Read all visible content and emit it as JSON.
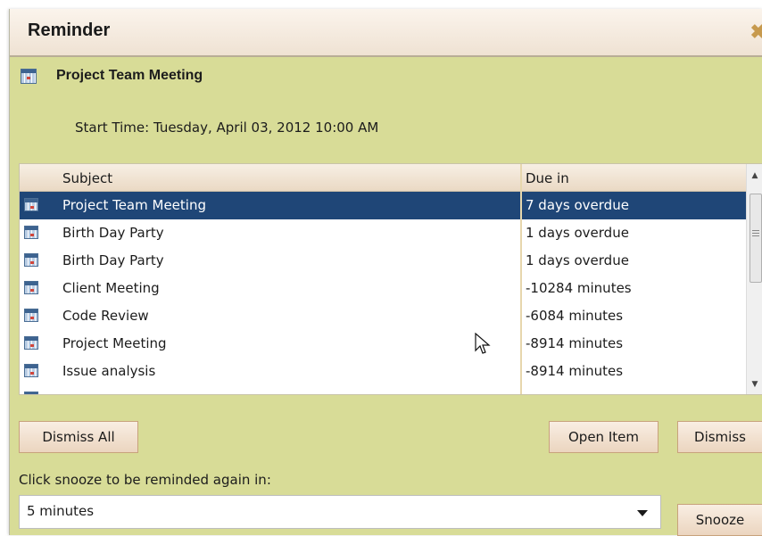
{
  "window": {
    "title": "Reminder",
    "close_glyph": "✖"
  },
  "header": {
    "item_title": "Project Team Meeting",
    "start_time": "Start Time: Tuesday, April 03, 2012 10:00 AM"
  },
  "list": {
    "columns": {
      "subject": "Subject",
      "due": "Due in"
    },
    "rows": [
      {
        "subject": "Project Team Meeting",
        "due": "7 days overdue",
        "selected": true
      },
      {
        "subject": "Birth Day Party",
        "due": "1 days overdue"
      },
      {
        "subject": "Birth Day Party",
        "due": "1 days overdue"
      },
      {
        "subject": "Client Meeting",
        "due": "-10284 minutes"
      },
      {
        "subject": "Code Review",
        "due": "-6084 minutes"
      },
      {
        "subject": "Project Meeting",
        "due": "-8914 minutes"
      },
      {
        "subject": "Issue analysis",
        "due": "-8914 minutes"
      }
    ]
  },
  "buttons": {
    "dismiss_all": "Dismiss All",
    "open_item": "Open Item",
    "dismiss": "Dismiss",
    "snooze": "Snooze"
  },
  "snooze": {
    "label": "Click snooze to be reminded again in:",
    "selected": "5 minutes"
  },
  "icons": {
    "item": "calendar-icon",
    "close": "close-icon",
    "cursor": "mouse-pointer-icon"
  },
  "colors": {
    "background": "#d8dc97",
    "selected_row": "#1f4677",
    "accent": "#c79a4e"
  }
}
